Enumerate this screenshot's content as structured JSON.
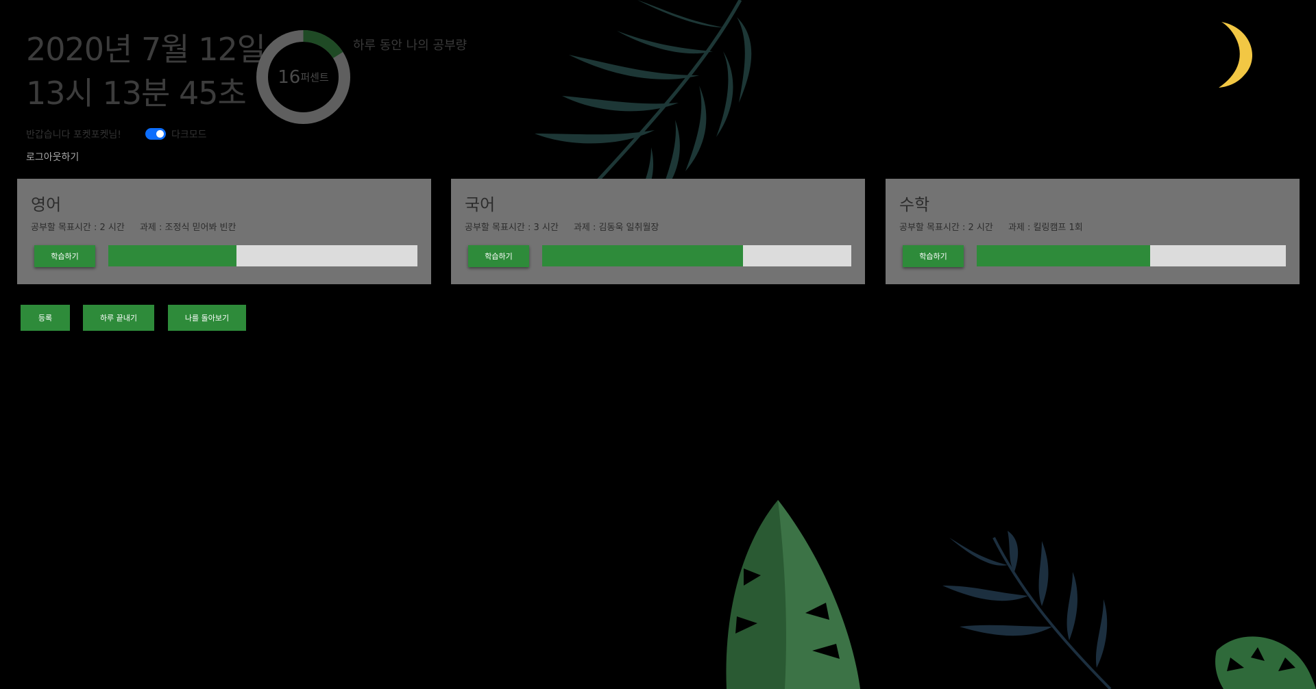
{
  "header": {
    "date_line": "2020년 7월 12일",
    "time_line": "13시 13분 45초",
    "donut_value": "16",
    "donut_unit": "퍼센트",
    "donut_title": "하루 동안 나의 공부량",
    "progress_fraction": 0.16,
    "greeting": "반갑습니다 포켓포켓님!",
    "darkmode_label": "다크모드",
    "darkmode_on": true,
    "logout": "로그아웃하기"
  },
  "subjects": [
    {
      "name": "영어",
      "goal": "공부할 목표시간 : 2 시간",
      "task": "과제 : 조정식 믿어봐 빈칸",
      "button": "학습하기",
      "progress": 0.415
    },
    {
      "name": "국어",
      "goal": "공부할 목표시간 : 3 시간",
      "task": "과제 : 김동욱 일취월장",
      "button": "학습하기",
      "progress": 0.65
    },
    {
      "name": "수학",
      "goal": "공부할 목표시간 : 2 시간",
      "task": "과제 : 킬링캠프 1회",
      "button": "학습하기",
      "progress": 0.56
    }
  ],
  "actions": {
    "register": "등록",
    "end_day": "하루 끝내기",
    "review": "나를 돌아보기"
  },
  "colors": {
    "accent_green": "#2e8b3a",
    "card_gray": "#737373",
    "moon": "#f2c744",
    "toggle_blue": "#0d6efd"
  }
}
